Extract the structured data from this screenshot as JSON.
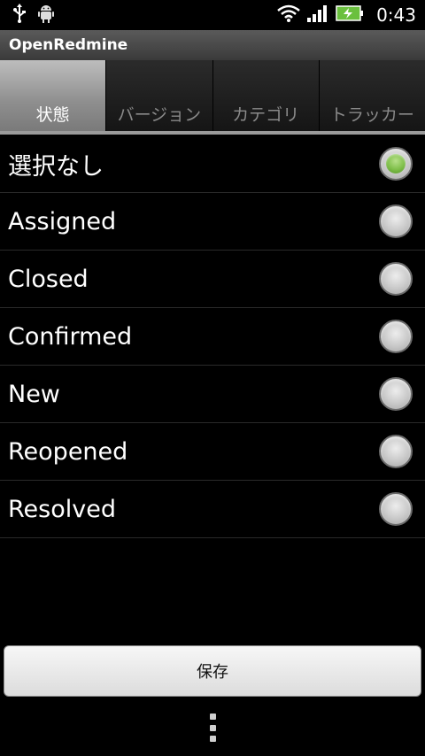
{
  "status_bar": {
    "time": "0:43",
    "icons": [
      "usb-icon",
      "android-debug-icon",
      "wifi-icon",
      "signal-icon",
      "battery-charging-icon"
    ]
  },
  "app": {
    "title": "OpenRedmine"
  },
  "tabs": [
    {
      "label": "状態",
      "active": true
    },
    {
      "label": "バージョン",
      "active": false
    },
    {
      "label": "カテゴリ",
      "active": false
    },
    {
      "label": "トラッカー",
      "active": false
    }
  ],
  "options": [
    {
      "label": "選択なし",
      "selected": true
    },
    {
      "label": "Assigned",
      "selected": false
    },
    {
      "label": "Closed",
      "selected": false
    },
    {
      "label": "Confirmed",
      "selected": false
    },
    {
      "label": "New",
      "selected": false
    },
    {
      "label": "Reopened",
      "selected": false
    },
    {
      "label": "Resolved",
      "selected": false
    }
  ],
  "actions": {
    "save_label": "保存"
  },
  "colors": {
    "selected_radio": "#7fbf4a",
    "background": "#000000"
  }
}
